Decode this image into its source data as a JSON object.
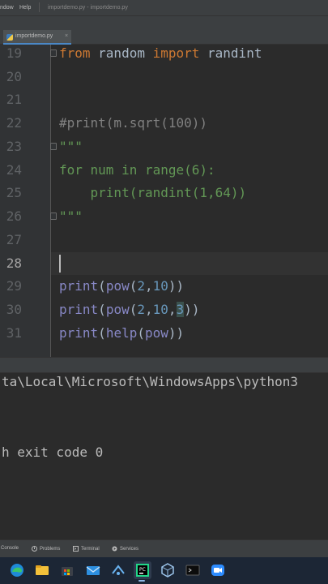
{
  "menubar": {
    "items": [
      "ndow",
      "Help"
    ],
    "path": "importdemo.py - importdemo.py"
  },
  "tabs": [
    {
      "label": "importdemo.py",
      "close": "×"
    }
  ],
  "editor": {
    "line_numbers": [
      "19",
      "20",
      "21",
      "22",
      "23",
      "24",
      "25",
      "26",
      "27",
      "28",
      "29",
      "30",
      "31"
    ],
    "current_line": "28"
  },
  "code": {
    "l19": [
      "from",
      " random ",
      "import",
      " randint"
    ],
    "l22": "#print(m.sqrt(100))",
    "l23": "\"\"\"",
    "l24": "for num in range(6):",
    "l25": "    print(randint(1,64))",
    "l26": "\"\"\"",
    "l29": [
      "print",
      "(",
      "pow",
      "(",
      "2",
      ",",
      "10",
      "))"
    ],
    "l30": [
      "print",
      "(",
      "pow",
      "(",
      "2",
      ",",
      "10",
      ",",
      "3",
      "))"
    ],
    "l31": [
      "print",
      "(",
      "help",
      "(",
      "pow",
      "))"
    ]
  },
  "console": {
    "line1": "ta\\Local\\Microsoft\\WindowsApps\\python3",
    "line2": "h exit code 0"
  },
  "tool_windows": [
    {
      "label": "Console",
      "icon": "console-icon"
    },
    {
      "label": "Problems",
      "icon": "problems-icon"
    },
    {
      "label": "Terminal",
      "icon": "terminal-icon"
    },
    {
      "label": "Services",
      "icon": "services-icon"
    }
  ],
  "taskbar": {
    "apps": [
      "edge-icon",
      "file-explorer-icon",
      "store-icon",
      "mail-icon",
      "vscode-share-icon",
      "powerpoint-icon",
      "pycharm-icon",
      "virtualbox-icon",
      "terminal-app-icon",
      "zoom-icon"
    ],
    "active_app": "pycharm-icon"
  },
  "colors": {
    "keyword": "#cc7832",
    "comment": "#808080",
    "docstring": "#629755",
    "number": "#6897bb",
    "builtin": "#8888c6",
    "text": "#a9b7c6",
    "background": "#2b2b2b"
  }
}
